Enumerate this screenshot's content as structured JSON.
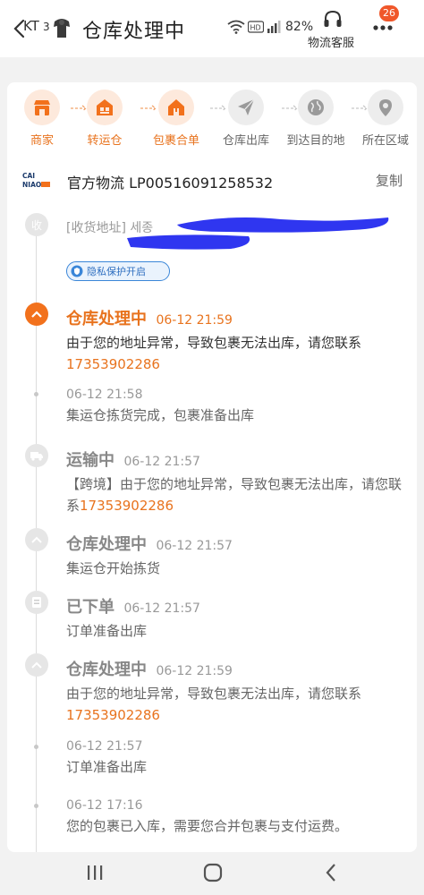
{
  "status_bar": {
    "left_text": "KT",
    "left_number": "3",
    "battery": "82%"
  },
  "header": {
    "title": "仓库处理中",
    "service_label": "物流客服",
    "badge_count": "26"
  },
  "steps": [
    {
      "label": "商家",
      "icon": "store-icon",
      "active": true
    },
    {
      "label": "转运仓",
      "icon": "warehouse-icon",
      "active": true
    },
    {
      "label": "包裹合单",
      "icon": "house-icon",
      "active": true
    },
    {
      "label": "仓库出库",
      "icon": "paper-plane-icon",
      "active": false
    },
    {
      "label": "到达目的地",
      "icon": "globe-icon",
      "active": false
    },
    {
      "label": "所在区域",
      "icon": "location-pin-icon",
      "active": false
    }
  ],
  "carrier": {
    "logo_text": "CAI NIAO 菜鸟",
    "text": "官方物流 LP00516091258532",
    "copy_label": "复制"
  },
  "address": {
    "icon_label": "收",
    "text": "[收货地址] 세종",
    "privacy_label": "隐私保护开启"
  },
  "events": [
    {
      "status": "仓库处理中",
      "time": "06-12 21:59",
      "body": "由于您的地址异常，导致包裹无法出库，请您联系",
      "phone": "17353902286"
    },
    {
      "status": "",
      "time": "06-12 21:58",
      "body": "集运仓拣货完成，包裹准备出库",
      "phone": ""
    },
    {
      "status": "运输中",
      "time": "06-12 21:57",
      "body": "【跨境】由于您的地址异常，导致包裹无法出库，请您联系",
      "phone": "17353902286"
    },
    {
      "status": "仓库处理中",
      "time": "06-12 21:57",
      "body": "集运仓开始拣货",
      "phone": ""
    },
    {
      "status": "已下单",
      "time": "06-12 21:57",
      "body": "订单准备出库",
      "phone": ""
    },
    {
      "status": "仓库处理中",
      "time": "06-12 21:59",
      "body": "由于您的地址异常，导致包裹无法出库，请您联系",
      "phone": "17353902286"
    },
    {
      "status": "",
      "time": "06-12 21:57",
      "body": "订单准备出库",
      "phone": ""
    },
    {
      "status": "",
      "time": "06-12 17:16",
      "body": "您的包裹已入库，需要您合并包裹与支付运费。",
      "phone": ""
    }
  ],
  "colors": {
    "accent": "#e8731e",
    "badge": "#f0572a",
    "privacy": "#3a86d8",
    "redaction": "#2f36f0"
  }
}
